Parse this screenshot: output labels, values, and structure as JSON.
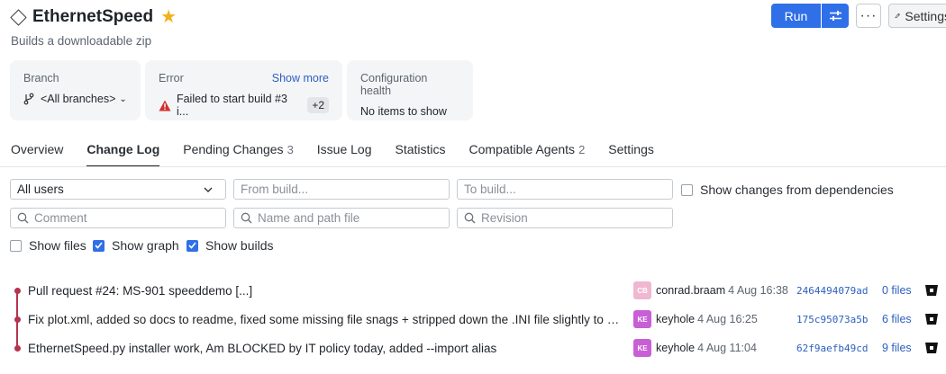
{
  "header": {
    "title": "EthernetSpeed",
    "subtitle": "Builds a downloadable zip",
    "run_label": "Run",
    "settings_label": "Settings"
  },
  "cards": {
    "branch": {
      "label": "Branch",
      "value": "<All branches>"
    },
    "error": {
      "label": "Error",
      "link": "Show more",
      "value": "Failed to start build #3 i...",
      "badge": "+2"
    },
    "health": {
      "label": "Configuration health",
      "value": "No items to show"
    }
  },
  "tabs": [
    {
      "label": "Overview",
      "count": ""
    },
    {
      "label": "Change Log",
      "count": ""
    },
    {
      "label": "Pending Changes",
      "count": "3"
    },
    {
      "label": "Issue Log",
      "count": ""
    },
    {
      "label": "Statistics",
      "count": ""
    },
    {
      "label": "Compatible Agents",
      "count": "2"
    },
    {
      "label": "Settings",
      "count": ""
    }
  ],
  "filters": {
    "users_value": "All users",
    "from_placeholder": "From build...",
    "to_placeholder": "To build...",
    "deps_label": "Show changes from dependencies",
    "comment_placeholder": "Comment",
    "path_placeholder": "Name and path file",
    "revision_placeholder": "Revision",
    "show_files_label": "Show files",
    "show_graph_label": "Show graph",
    "show_builds_label": "Show builds"
  },
  "changes": [
    {
      "description": "Pull request #24: MS-901 speeddemo [...]",
      "avatar": "CB",
      "author": "conrad.braam",
      "date": "4 Aug 16:38",
      "revision": "2464494079ad",
      "files": "0 files",
      "avatar_color": "#f0b7d0"
    },
    {
      "description": "Fix plot.xml, added so docs to readme, fixed some missing file snags + stripped down the .INI file slightly to shorten a bit",
      "avatar": "KE",
      "author": "keyhole",
      "date": "4 Aug 16:25",
      "revision": "175c95073a5b",
      "files": "6 files",
      "avatar_color": "#c95fd6"
    },
    {
      "description": "EthernetSpeed.py installer work, Am BLOCKED by IT policy today, added --import alias",
      "avatar": "KE",
      "author": "keyhole",
      "date": "4 Aug 11:04",
      "revision": "62f9aefb49cd",
      "files": "9 files",
      "avatar_color": "#c95fd6"
    }
  ],
  "colors": {
    "accent": "#2f6fe8",
    "graph": "#b5334f",
    "star": "#f2b01e",
    "error": "#d1302f"
  }
}
